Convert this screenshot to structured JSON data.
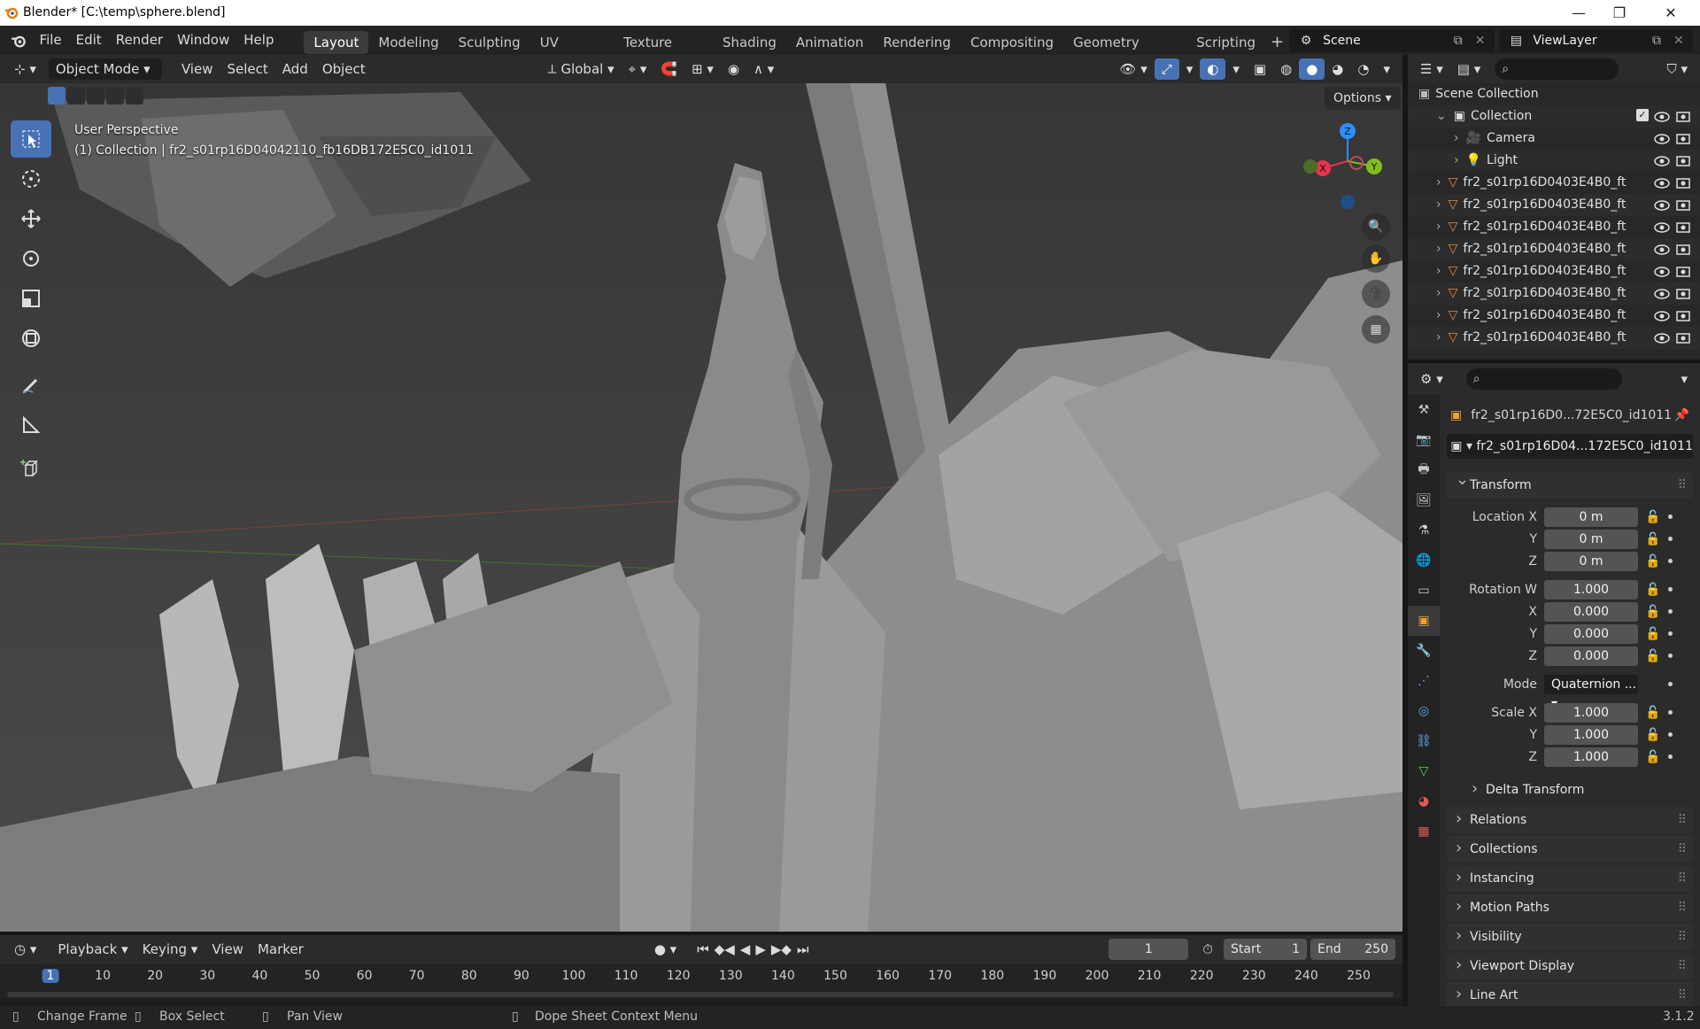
{
  "window": {
    "title": "Blender* [C:\\temp\\sphere.blend]"
  },
  "menus": [
    "File",
    "Edit",
    "Render",
    "Window",
    "Help"
  ],
  "workspaces": [
    "Layout",
    "Modeling",
    "Sculpting",
    "UV Editing",
    "Texture Paint",
    "Shading",
    "Animation",
    "Rendering",
    "Compositing",
    "Geometry Nodes",
    "Scripting"
  ],
  "active_workspace": "Layout",
  "scene": {
    "name": "Scene",
    "view_layer": "ViewLayer"
  },
  "viewport_header": {
    "mode": "Object Mode",
    "menus": [
      "View",
      "Select",
      "Add",
      "Object"
    ],
    "orientation": "Global",
    "options": "Options"
  },
  "viewport": {
    "perspective": "User Perspective",
    "context": "(1) Collection | fr2_s01rp16D04042110_fb16DB172E5C0_id1011",
    "gizmo_axes": [
      "X",
      "Y",
      "Z"
    ]
  },
  "outliner": {
    "root": "Scene Collection",
    "collection": "Collection",
    "items": [
      {
        "name": "Camera",
        "icon": "camera-icon"
      },
      {
        "name": "Light",
        "icon": "light-icon"
      },
      {
        "name": "fr2_s01rp16D0403E4B0_ft",
        "icon": "mesh-icon"
      },
      {
        "name": "fr2_s01rp16D0403E4B0_ft",
        "icon": "mesh-icon"
      },
      {
        "name": "fr2_s01rp16D0403E4B0_ft",
        "icon": "mesh-icon"
      },
      {
        "name": "fr2_s01rp16D0403E4B0_ft",
        "icon": "mesh-icon"
      },
      {
        "name": "fr2_s01rp16D0403E4B0_ft",
        "icon": "mesh-icon"
      },
      {
        "name": "fr2_s01rp16D0403E4B0_ft",
        "icon": "mesh-icon"
      },
      {
        "name": "fr2_s01rp16D0403E4B0_ft",
        "icon": "mesh-icon"
      },
      {
        "name": "fr2_s01rp16D0403E4B0_ft",
        "icon": "mesh-icon"
      }
    ]
  },
  "properties": {
    "object_name": "fr2_s01rp16D0...72E5C0_id1011",
    "data_name": "fr2_s01rp16D04...172E5C0_id1011",
    "transform": {
      "title": "Transform",
      "location": {
        "label": "Location X",
        "x": "0 m",
        "y": "0 m",
        "z": "0 m"
      },
      "rotation": {
        "label": "Rotation W",
        "w": "1.000",
        "x": "0.000",
        "y": "0.000",
        "z": "0.000"
      },
      "mode_label": "Mode",
      "mode": "Quaternion ...",
      "scale": {
        "label": "Scale X",
        "x": "1.000",
        "y": "1.000",
        "z": "1.000"
      },
      "axis_labels": {
        "x": "X",
        "y": "Y",
        "z": "Z"
      }
    },
    "delta": "Delta Transform",
    "panels": [
      "Relations",
      "Collections",
      "Instancing",
      "Motion Paths",
      "Visibility",
      "Viewport Display",
      "Line Art"
    ]
  },
  "timeline": {
    "menus": [
      "Playback",
      "Keying",
      "View",
      "Marker"
    ],
    "current_frame": "1",
    "start_label": "Start",
    "start": "1",
    "end_label": "End",
    "end": "250",
    "ticks": [
      "1",
      "10",
      "20",
      "30",
      "40",
      "50",
      "60",
      "70",
      "80",
      "90",
      "100",
      "110",
      "120",
      "130",
      "140",
      "150",
      "160",
      "170",
      "180",
      "190",
      "200",
      "210",
      "220",
      "230",
      "240",
      "250"
    ]
  },
  "statusbar": {
    "items": [
      "Change Frame",
      "Box Select",
      "Pan View",
      "Dope Sheet Context Menu"
    ],
    "version": "3.1.2"
  },
  "colors": {
    "accent": "#4772b3",
    "x_axis": "#e8344f",
    "y_axis": "#80bd1c",
    "z_axis": "#2c8fff",
    "mesh_orange": "#e88a3a"
  }
}
